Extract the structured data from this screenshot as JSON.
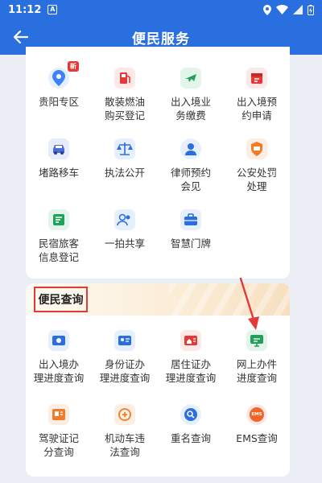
{
  "status": {
    "time": "11:12",
    "a_label": "A"
  },
  "header": {
    "title": "便民服务"
  },
  "services": [
    {
      "label": "贵阳专区",
      "badge": "新"
    },
    {
      "label": "散装燃油\n购买登记"
    },
    {
      "label": "出入境业\n务缴费"
    },
    {
      "label": "出入境预\n约申请"
    },
    {
      "label": "堵路移车"
    },
    {
      "label": "执法公开"
    },
    {
      "label": "律师预约\n会见"
    },
    {
      "label": "公安处罚\n处理"
    },
    {
      "label": "民宿旅客\n信息登记"
    },
    {
      "label": "一拍共享"
    },
    {
      "label": "智慧门牌"
    }
  ],
  "query_section": {
    "title": "便民查询",
    "items": [
      {
        "label": "出入境办\n理进度查询"
      },
      {
        "label": "身份证办\n理进度查询"
      },
      {
        "label": "居住证办\n理进度查询"
      },
      {
        "label": "网上办件\n进度查询"
      },
      {
        "label": "驾驶证记\n分查询"
      },
      {
        "label": "机动车违\n法查询"
      },
      {
        "label": "重名查询"
      },
      {
        "label": "EMS查询",
        "icon_text": "EMS"
      }
    ]
  },
  "colors": {
    "primary": "#2a6fe0",
    "highlight": "#e53935"
  }
}
